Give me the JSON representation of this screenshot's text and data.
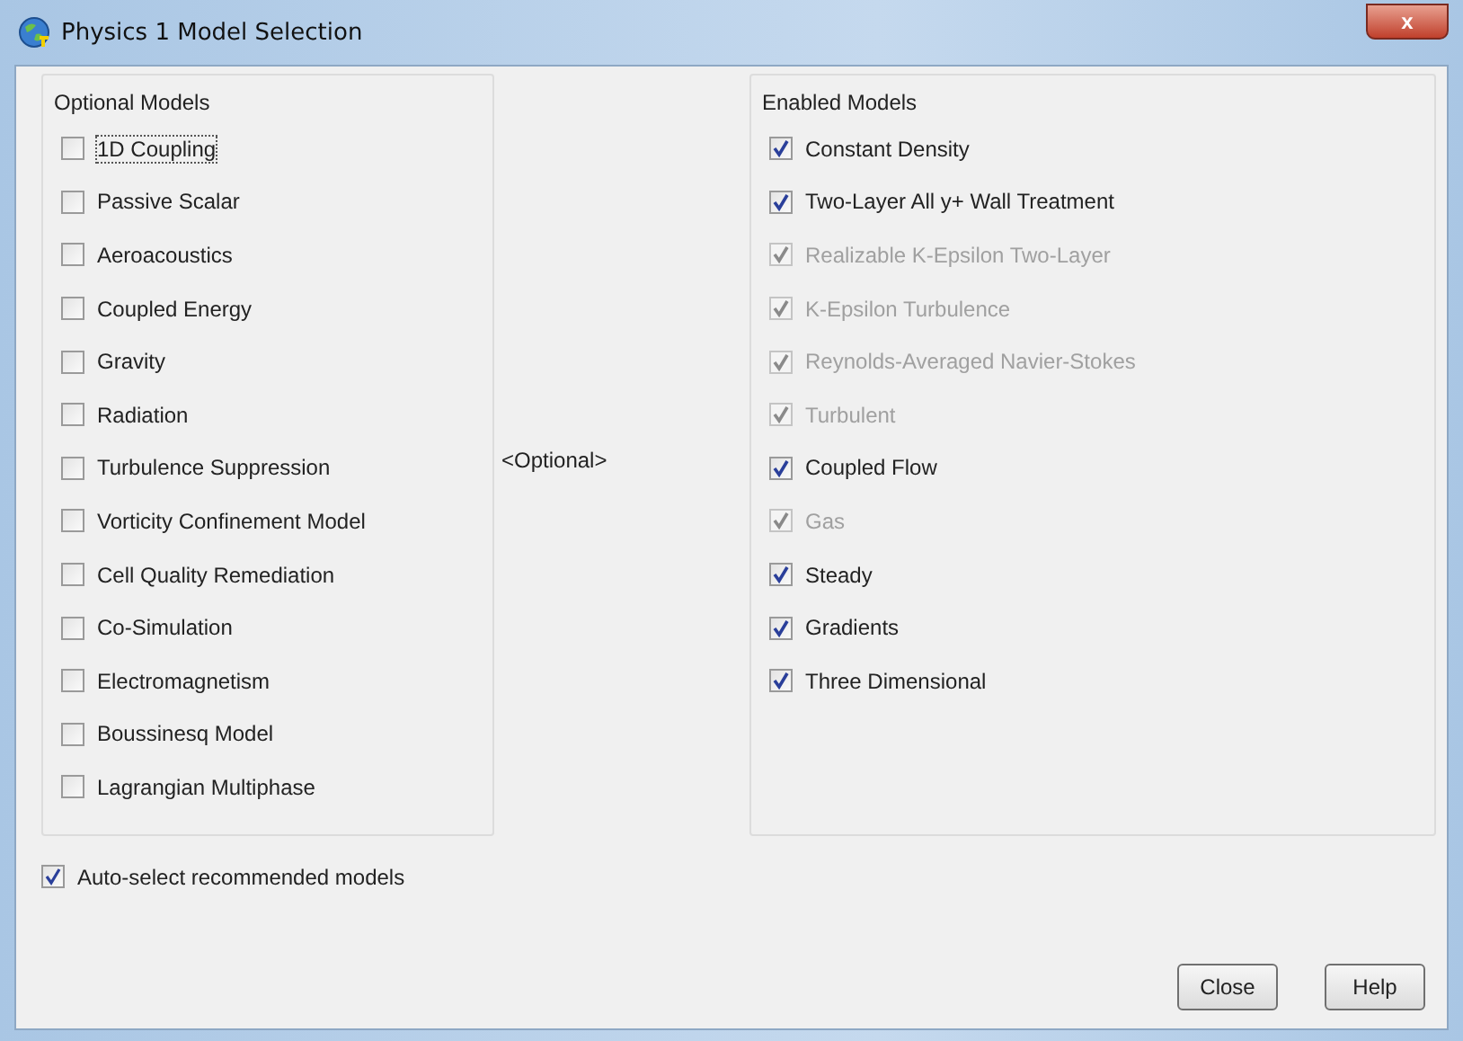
{
  "window": {
    "title": "Physics 1 Model Selection",
    "close_label": "x"
  },
  "optional_models": {
    "title": "Optional Models",
    "items": [
      {
        "label": "1D Coupling",
        "checked": false,
        "disabled": false
      },
      {
        "label": "Passive Scalar",
        "checked": false,
        "disabled": false
      },
      {
        "label": "Aeroacoustics",
        "checked": false,
        "disabled": false
      },
      {
        "label": "Coupled Energy",
        "checked": false,
        "disabled": false
      },
      {
        "label": "Gravity",
        "checked": false,
        "disabled": false
      },
      {
        "label": "Radiation",
        "checked": false,
        "disabled": false
      },
      {
        "label": "Turbulence Suppression",
        "checked": false,
        "disabled": false
      },
      {
        "label": "Vorticity Confinement Model",
        "checked": false,
        "disabled": false
      },
      {
        "label": "Cell Quality Remediation",
        "checked": false,
        "disabled": false
      },
      {
        "label": "Co-Simulation",
        "checked": false,
        "disabled": false
      },
      {
        "label": "Electromagnetism",
        "checked": false,
        "disabled": false
      },
      {
        "label": "Boussinesq Model",
        "checked": false,
        "disabled": false
      },
      {
        "label": "Lagrangian Multiphase",
        "checked": false,
        "disabled": false
      }
    ]
  },
  "middle_label": "<Optional>",
  "enabled_models": {
    "title": "Enabled Models",
    "items": [
      {
        "label": "Constant Density",
        "checked": true,
        "disabled": false
      },
      {
        "label": "Two-Layer All y+ Wall Treatment",
        "checked": true,
        "disabled": false
      },
      {
        "label": "Realizable K-Epsilon Two-Layer",
        "checked": true,
        "disabled": true
      },
      {
        "label": "K-Epsilon Turbulence",
        "checked": true,
        "disabled": true
      },
      {
        "label": "Reynolds-Averaged Navier-Stokes",
        "checked": true,
        "disabled": true
      },
      {
        "label": "Turbulent",
        "checked": true,
        "disabled": true
      },
      {
        "label": "Coupled Flow",
        "checked": true,
        "disabled": false
      },
      {
        "label": "Gas",
        "checked": true,
        "disabled": true
      },
      {
        "label": "Steady",
        "checked": true,
        "disabled": false
      },
      {
        "label": "Gradients",
        "checked": true,
        "disabled": false
      },
      {
        "label": "Three Dimensional",
        "checked": true,
        "disabled": false
      }
    ]
  },
  "auto_select": {
    "label": "Auto-select recommended models",
    "checked": true
  },
  "buttons": [
    "Close",
    "Help"
  ]
}
